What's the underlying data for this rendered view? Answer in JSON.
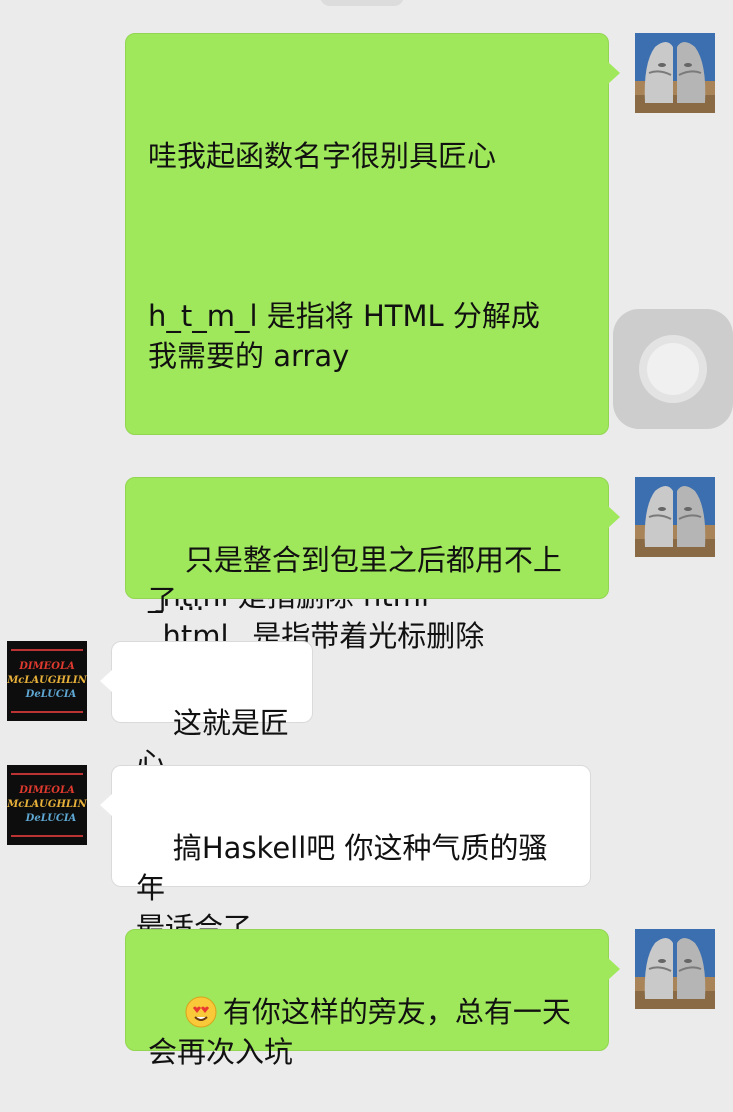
{
  "messages": [
    {
      "id": 1,
      "sender": "me",
      "paragraphs": [
        "哇我起函数名字很别具匠心",
        "h_t_m_l 是指将 HTML 分解成\n我需要的 array",
        "html 是指输入 html\nhtml_ 是指带着光标输入\n_html 是指删除 html\n_html_ 是指带着光标删除"
      ]
    },
    {
      "id": 2,
      "sender": "me",
      "text": "只是整合到包里之后都用不上\n了..."
    },
    {
      "id": 3,
      "sender": "them",
      "text": "这就是匠心",
      "avatar_caption": [
        "DIMEOLA",
        "McLAUGHLIN",
        "DeLUCIA"
      ]
    },
    {
      "id": 4,
      "sender": "them",
      "text": "搞Haskell吧 你这种气质的骚年\n最适合了",
      "avatar_caption": [
        "DIMEOLA",
        "McLAUGHLIN",
        "DeLUCIA"
      ]
    },
    {
      "id": 5,
      "sender": "me",
      "emoji": "heart-eyes-emoji",
      "text": "有你这样的旁友，总有一天\n会再次入坑"
    }
  ],
  "colors": {
    "background": "#ebebeb",
    "my_bubble": "#a0e85b",
    "their_bubble": "#ffffff"
  }
}
